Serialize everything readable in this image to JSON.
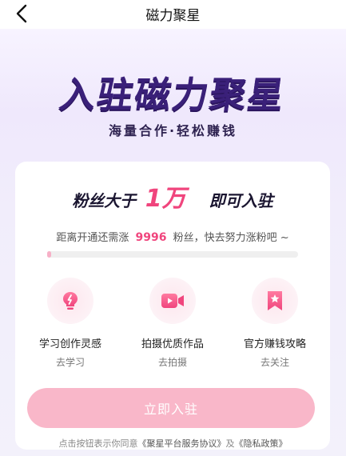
{
  "nav": {
    "title": "磁力聚星"
  },
  "hero": {
    "title": "入驻磁力聚星",
    "subtitle": "海量合作·轻松赚钱"
  },
  "card": {
    "headline_prefix": "粉丝大于",
    "headline_number": "1万",
    "headline_suffix": "即可入驻",
    "progress_prefix": "距离开通还需涨",
    "progress_number": "9996",
    "progress_suffix": "粉丝，快去努力涨粉吧 ~",
    "progress_fraction": 0.0004,
    "features": [
      {
        "title": "学习创作灵感",
        "link": "去学习",
        "icon": "lightbulb-icon"
      },
      {
        "title": "拍摄优质作品",
        "link": "去拍摄",
        "icon": "video-camera-icon"
      },
      {
        "title": "官方赚钱攻略",
        "link": "去关注",
        "icon": "bookmark-star-icon"
      }
    ],
    "join_label": "立即入驻"
  },
  "agreement": {
    "prefix": "点击按钮表示你同意",
    "link1": "《聚星平台服务协议》",
    "conj": "及",
    "link2": "《隐私政策》"
  },
  "colors": {
    "accent_pink": "#f0457d",
    "button_pink": "#f9b7c9",
    "hero_purple": "#3a2079"
  }
}
